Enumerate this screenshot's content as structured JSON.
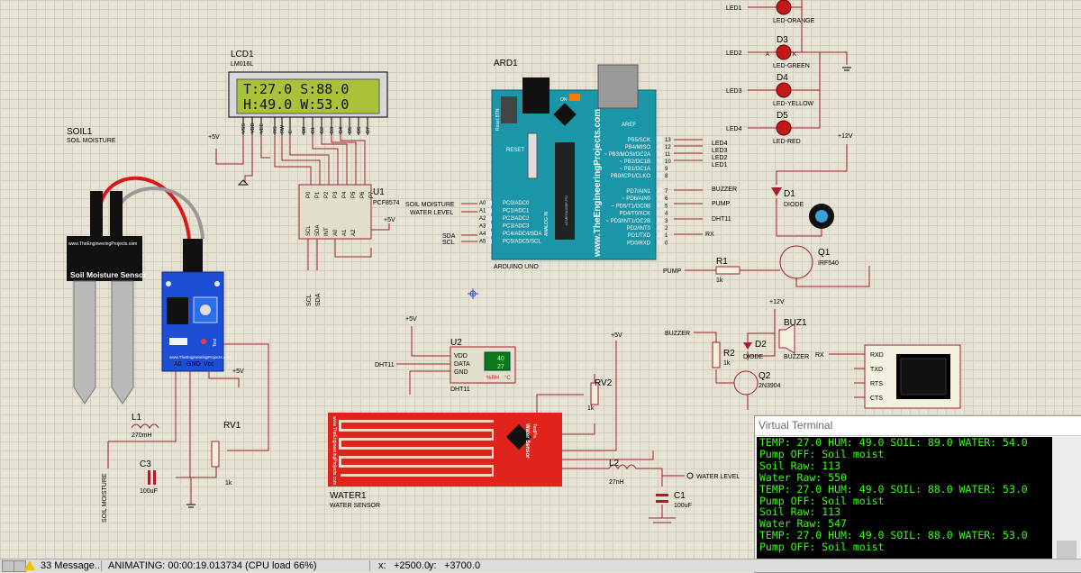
{
  "schematic": {
    "lcd": {
      "ref": "LCD1",
      "part": "LM016L",
      "line1": "T:27.0 S:88.0",
      "line2": "H:49.0 W:53.0",
      "pins": [
        "VSS",
        "VDD",
        "VEE",
        "RS",
        "RW",
        "E",
        "D0",
        "D1",
        "D2",
        "D3",
        "D4",
        "D5",
        "D6",
        "D7"
      ]
    },
    "arduino": {
      "ref": "ARD1",
      "part": "ARDUINO UNO",
      "brand": "www.TheEngineeringProjects.com",
      "reset_btn": "Reset BTN",
      "reset": "RESET",
      "aref": "AREF",
      "on": "ON",
      "analog_label": "ANALOG IN",
      "chip": "ATMEGA328P-PU",
      "left_pins": [
        "A0 PC0/ADC0",
        "A1 PC1/ADC1",
        "A2 PC2/ADC2",
        "A3 PC3/ADC3",
        "A4 PC4/ADC4/SDA",
        "A5 PC5/ADC5/SCL"
      ],
      "right_pins_top": [
        "PB5/SCK",
        "PB4/MISO",
        "~ PB3/MOSI/OC2A",
        "~ PB2/OC1B",
        "~ PB1/OC1A",
        "PB0/ICP1/CLKO"
      ],
      "right_pins_bottom": [
        "PD7/AIN1",
        "~ PD6/AIN0",
        "~ PD5/T1/OC0B",
        "PD4/T0/XCK",
        "~ PD3/INT1/OC2B",
        "PD2/INT0",
        "PD1/TXD",
        "PD0/RXD"
      ]
    },
    "pcf": {
      "ref": "U1",
      "part": "PCF8574",
      "pins_top": [
        "P0",
        "P1",
        "P2",
        "P3",
        "P4",
        "P5",
        "P6",
        "P7"
      ],
      "pins_bottom": [
        "SCL",
        "SDA",
        "INT",
        "A0",
        "A1",
        "A2"
      ]
    },
    "soil": {
      "ref": "SOIL1",
      "part": "SOIL MOISTURE",
      "board_text": "Soil Moisture Sensor",
      "site": "www.TheEngineeringProjects.com",
      "pins": [
        "A0",
        "GND",
        "Vcc"
      ],
      "test": "Test"
    },
    "water": {
      "ref": "WATER1",
      "part": "WATER SENSOR",
      "board_text": "Water Sensor",
      "site": "www.TheEngineeringProjects.com",
      "testpin": "TestPin"
    },
    "dht": {
      "ref": "U2",
      "part": "DHT11",
      "pins": [
        "VDD",
        "DATA",
        "GND"
      ],
      "temp": "40",
      "hum": "27",
      "rh": "%RH",
      "deg": "°C"
    },
    "leds": [
      {
        "ref": "",
        "net": "LED1",
        "name": "LED-ORANGE"
      },
      {
        "ref": "D3",
        "net": "LED2",
        "name": "LED-GREEN"
      },
      {
        "ref": "D4",
        "net": "LED3",
        "name": "LED-YELLOW"
      },
      {
        "ref": "D5",
        "net": "LED4",
        "name": "LED-RED"
      }
    ],
    "parts": {
      "d1": "D1",
      "d1_type": "DIODE",
      "q1": "Q1",
      "q1_type": "IRF540",
      "r1": "R1",
      "r1_val": "1k",
      "r2": "R2",
      "r2_val": "1k",
      "d2": "D2",
      "d2_type": "DIODE",
      "q2": "Q2",
      "q2_type": "2N3904",
      "buz": "BUZ1",
      "buz_type": "BUZZER",
      "rv1": "RV1",
      "rv1_val": "1k",
      "rv2": "RV2",
      "rv2_val": "1k",
      "l1": "L1",
      "l1_val": "270mH",
      "l2": "L2",
      "l2_val": "27nH",
      "c1": "C1",
      "c1_val": "100uF",
      "c3": "C3",
      "c3_val": "100uF"
    },
    "nets": {
      "soil_moisture": "SOIL MOISTURE",
      "water_level": "WATER LEVEL",
      "sda": "SDA",
      "scl": "SCL",
      "buzzer": "BUZZER",
      "pump": "PUMP",
      "dht11": "DHT11",
      "rx": "RX",
      "led1": "LED1",
      "led2": "LED2",
      "led3": "LED3",
      "led4": "LED4",
      "p5v": "+5V",
      "p12v": "+12V",
      "a": "A",
      "k": "K"
    },
    "vterm_pins": [
      "RXD",
      "TXD",
      "RTS",
      "CTS"
    ]
  },
  "terminal": {
    "title": "Virtual Terminal",
    "lines": [
      "TEMP: 27.0 HUM: 49.0 SOIL: 89.0 WATER: 54.0",
      "Pump OFF: Soil moist",
      "Soil Raw: 113",
      "Water Raw: 550",
      "TEMP: 27.0 HUM: 49.0 SOIL: 88.0 WATER: 53.0",
      "Pump OFF: Soil moist",
      "Soil Raw: 113",
      "Water Raw: 547",
      "TEMP: 27.0 HUM: 49.0 SOIL: 88.0 WATER: 53.0",
      "Pump OFF: Soil moist"
    ]
  },
  "statusbar": {
    "messages": "33 Message...",
    "animating": "ANIMATING: 00:00:19.013734 (CPU load 66%)",
    "x_label": "x:",
    "x_value": "+2500.0",
    "y_label": "y:",
    "y_value": "+3700.0"
  },
  "colors": {
    "grid_bg": "#e6e2d4",
    "arduino": "#1b95a8",
    "lcd_screen": "#a8c23a",
    "sensor_red": "#e0241c",
    "terminal_text": "#39ff14"
  }
}
